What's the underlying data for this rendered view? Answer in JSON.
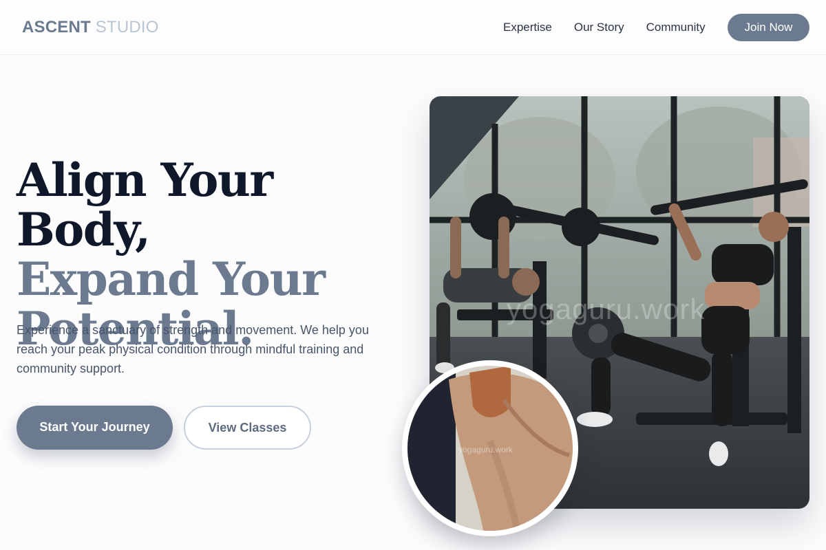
{
  "header": {
    "logo_brand": "ASCENT",
    "logo_sub": "STUDIO",
    "nav": [
      "Expertise",
      "Our Story",
      "Community"
    ],
    "cta": "Join Now"
  },
  "hero": {
    "headline_line1": "Align Your Body,",
    "headline_line2a": "Expand Your",
    "headline_line2b": "Potential.",
    "subtext": "Experience a sanctuary of strength and movement. We help you reach your peak physical condition through mindful training and community support.",
    "primary_button": "Start Your Journey",
    "secondary_button": "View Classes"
  },
  "images": {
    "main_watermark": "yogaguru.work",
    "circle_watermark": "yogaguru.work"
  },
  "colors": {
    "accent": "#6b7a8f",
    "heading_dark": "#0f172a",
    "body_text": "#475569",
    "border": "#c5d0dc"
  }
}
